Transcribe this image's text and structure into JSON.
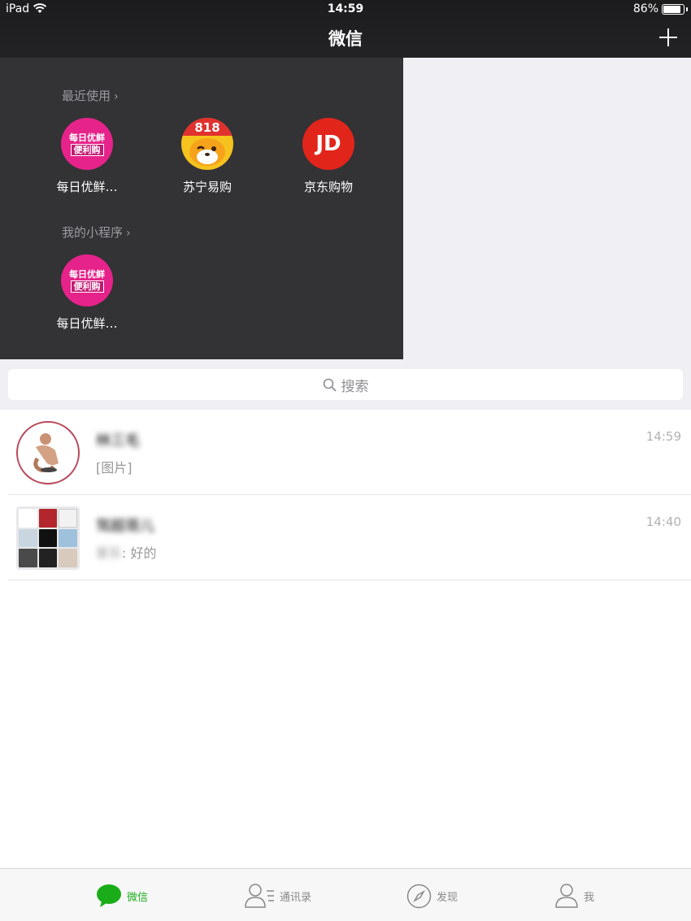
{
  "status_bar": {
    "device": "iPad",
    "time": "14:59",
    "battery": "86%"
  },
  "nav": {
    "title": "微信"
  },
  "mini_programs": {
    "recent_title": "最近使用",
    "recent": [
      {
        "name": "每日优鲜…",
        "icon": "mryx-icon"
      },
      {
        "name": "苏宁易购",
        "icon": "suning-icon"
      },
      {
        "name": "京东购物",
        "icon": "jd-icon"
      }
    ],
    "mine_title": "我的小程序",
    "mine": [
      {
        "name": "每日优鲜…",
        "icon": "mryx-icon"
      }
    ],
    "mryx_logo": {
      "line1": "每日优鲜",
      "line2": "便利购"
    },
    "jd_logo": "JD",
    "suning_badge": "818"
  },
  "search": {
    "placeholder": "搜索"
  },
  "chats": [
    {
      "name": "林三毛",
      "time": "14:59",
      "preview": "[图片]"
    },
    {
      "name": "驾超哥儿",
      "time": "14:40",
      "sender": "家乐",
      "preview": ": 好的"
    }
  ],
  "tabs": [
    {
      "label": "微信",
      "active": true
    },
    {
      "label": "通讯录"
    },
    {
      "label": "发现"
    },
    {
      "label": "我"
    }
  ],
  "colors": {
    "accent": "#1aad19",
    "panel_bg": "#333235",
    "nav_bg": "#1c1c1e"
  }
}
